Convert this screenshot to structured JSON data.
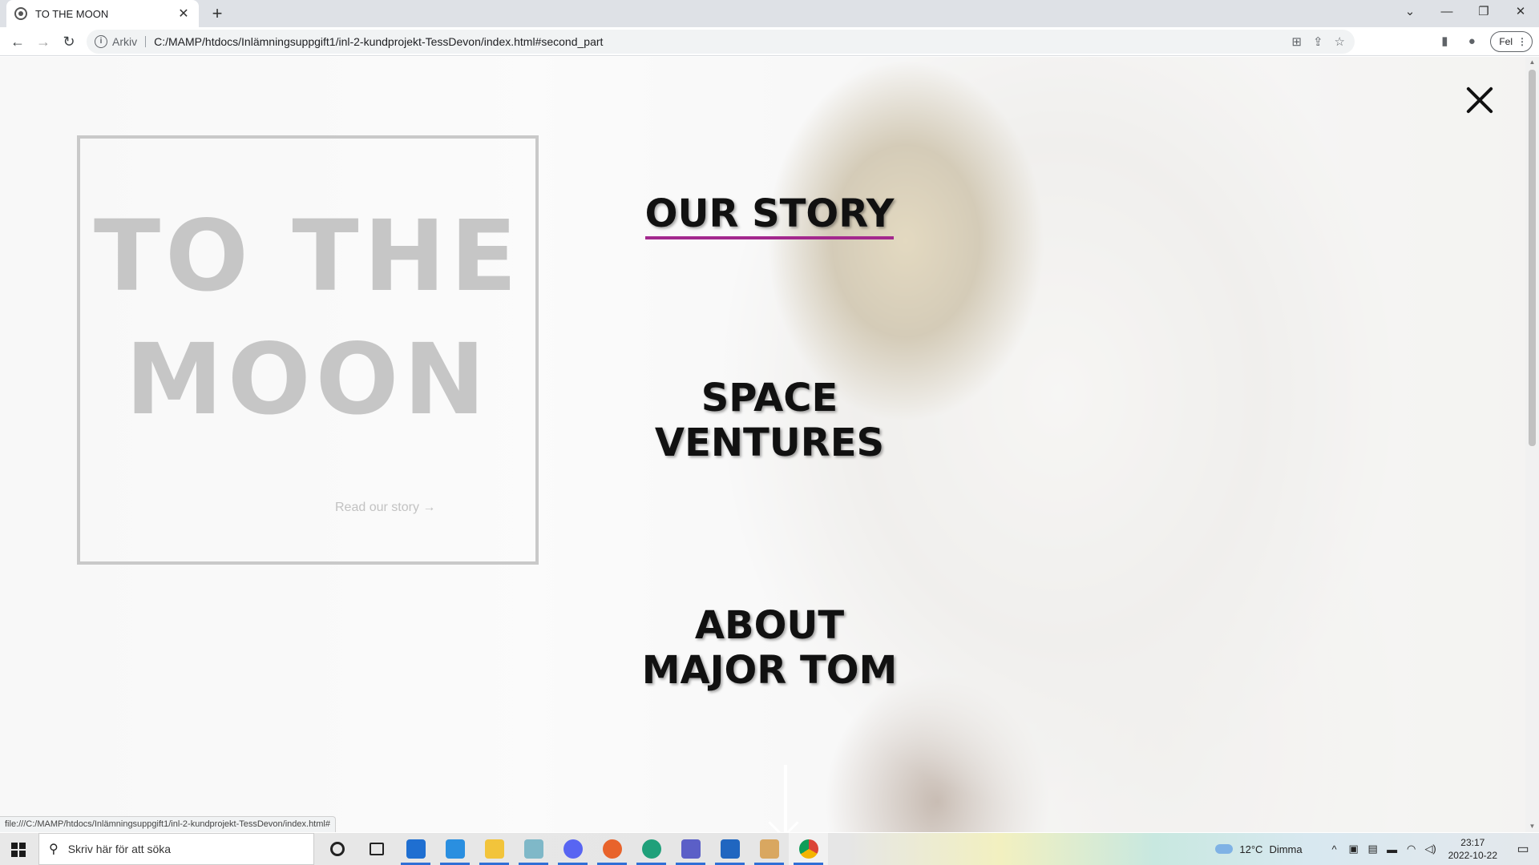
{
  "browser": {
    "tab_title": "TO THE MOON",
    "tab_close": "✕",
    "new_tab": "+",
    "address_scheme_label": "Arkiv",
    "address_url": "C:/MAMP/htdocs/Inlämningsuppgift1/inl-2-kundprojekt-TessDevon/index.html#second_part",
    "profile_label": "Fel",
    "status_url": "file:///C:/MAMP/htdocs/Inlämningsuppgift1/inl-2-kundprojekt-TessDevon/index.html#"
  },
  "page": {
    "hero_title_line1": "TO THE",
    "hero_title_line2": "MOON",
    "read_story": "Read our story →",
    "menu": [
      {
        "label": "OUR STORY",
        "active": true
      },
      {
        "label_line1": "SPACE",
        "label_line2": "VENTURES"
      },
      {
        "label_line1": "ABOUT",
        "label_line2": "MAJOR TOM"
      }
    ],
    "accent_color": "#a3288e"
  },
  "taskbar": {
    "search_placeholder": "Skriv här för att söka",
    "weather_temp": "12°C",
    "weather_desc": "Dimma",
    "time": "23:17",
    "date": "2022-10-22",
    "apps": [
      "cortana-icon",
      "task-view-icon",
      "mail-icon",
      "vscode-icon",
      "file-explorer-icon",
      "app-icon",
      "discord-icon",
      "firefox-icon",
      "edge-icon",
      "teams-icon",
      "photos-icon",
      "paint-icon",
      "chrome-icon"
    ]
  }
}
